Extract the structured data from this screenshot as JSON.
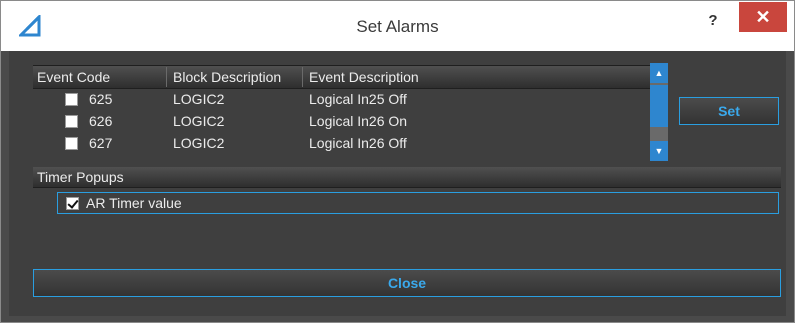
{
  "window": {
    "title": "Set Alarms",
    "help_label": "?",
    "close_label": "✕"
  },
  "table": {
    "headers": [
      "Event Code",
      "Block Description",
      "Event Description"
    ],
    "rows": [
      {
        "code": "625",
        "block": "LOGIC2",
        "description": "Logical In25 Off",
        "checked": false
      },
      {
        "code": "626",
        "block": "LOGIC2",
        "description": "Logical In26 On",
        "checked": false
      },
      {
        "code": "627",
        "block": "LOGIC2",
        "description": "Logical In26 Off",
        "checked": false
      }
    ]
  },
  "set_button": "Set",
  "timer": {
    "header": "Timer Popups",
    "item_label": "AR Timer value",
    "item_checked": true
  },
  "close_button": "Close",
  "colors": {
    "accent": "#2a9ee0",
    "close_red": "#c9463d",
    "panel": "#3f3f3f"
  },
  "icons": {
    "app": "app-triangle-icon",
    "scroll_up": "scroll-up-icon",
    "scroll_down": "scroll-down-icon",
    "check": "checkmark-icon"
  }
}
